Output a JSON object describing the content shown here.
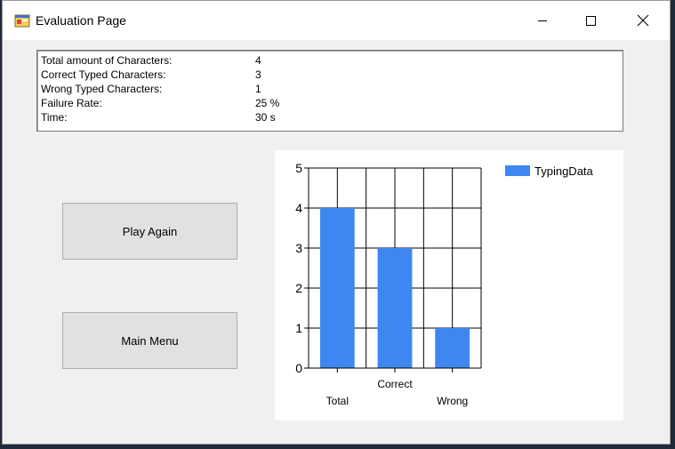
{
  "window": {
    "title": "Evaluation Page"
  },
  "stats": [
    {
      "label": "Total amount of Characters:",
      "value": "4"
    },
    {
      "label": "Correct Typed Characters:",
      "value": "3"
    },
    {
      "label": "Wrong Typed Characters:",
      "value": "1"
    },
    {
      "label": "Failure Rate:",
      "value": "25 %"
    },
    {
      "label": "Time:",
      "value": "30 s"
    }
  ],
  "buttons": {
    "play_again": "Play Again",
    "main_menu": "Main Menu"
  },
  "colors": {
    "bar": "#3f87f0",
    "window_bg": "#f0f0f0"
  },
  "icons": {
    "app": "app-window-icon",
    "minimize": "minimize-icon",
    "maximize": "maximize-icon",
    "close": "close-icon"
  },
  "chart_data": {
    "type": "bar",
    "categories": [
      "Total",
      "Correct",
      "Wrong"
    ],
    "series": [
      {
        "name": "TypingData",
        "values": [
          4,
          3,
          1
        ]
      }
    ],
    "ylim": [
      0,
      5
    ],
    "yticks": [
      "0",
      "1",
      "2",
      "3",
      "4",
      "5"
    ],
    "grid": true,
    "legend": "top-right"
  }
}
